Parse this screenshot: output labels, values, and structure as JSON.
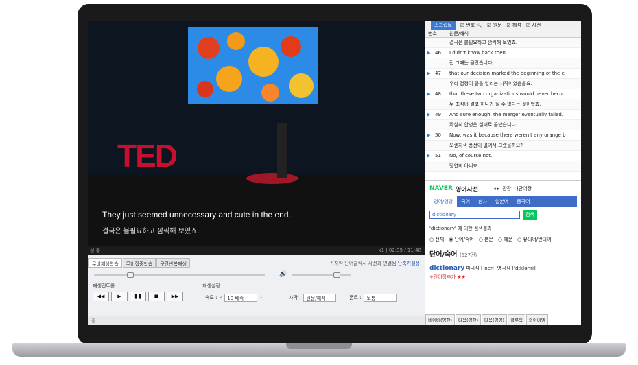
{
  "video": {
    "logo": "TED",
    "subtitle_en": "They just seemed unnecessary and cute in the end.",
    "subtitle_ko": "결국은 불필요하고 깜찍해 보였죠.",
    "status_left": "성 중",
    "status_right": "x1 | 02:39 / 11:48"
  },
  "controls": {
    "tabs": [
      "무비재생학습",
      "무비집중학습",
      "구간반복재생"
    ],
    "hint_text": "* 자막 단어클릭시 사전과 연결됨",
    "hint_link": "단축키설정",
    "playback_label": "재생컨트롤",
    "settings_label": "재생설정",
    "speed_label": "속도 :",
    "speed_value": "10 배속",
    "subtitle_label": "자막 :",
    "subtitle_value": "원문/해석",
    "font_label": "폰트 :",
    "font_value": "보통",
    "volume_level": 0.6
  },
  "bottom_status": "중",
  "transcript": {
    "toolbar": {
      "script": "스크립트",
      "number": "번호",
      "original": "원문",
      "translation": "해석",
      "dictionary": "사전"
    },
    "header": {
      "num": "번호",
      "text": "원문/해석"
    },
    "rows": [
      {
        "num": "",
        "text": "결국은 불필요하고 깜찍해 보였죠.",
        "lang": "ko"
      },
      {
        "num": "46",
        "text": "I didn't know back then",
        "lang": "en"
      },
      {
        "num": "",
        "text": "전 그때는 몰랐습니다.",
        "lang": "ko"
      },
      {
        "num": "47",
        "text": "that our decision marked the beginning of the e",
        "lang": "en"
      },
      {
        "num": "",
        "text": "우리 결정이 끝을 알리는 시작이었음을요.",
        "lang": "ko"
      },
      {
        "num": "48",
        "text": "that these two organizations would never becor",
        "lang": "en"
      },
      {
        "num": "",
        "text": "두 조직이 결코 하나가 될 수 없다는 것이었죠.",
        "lang": "ko"
      },
      {
        "num": "49",
        "text": "And sure enough, the merger eventually failed.",
        "lang": "en"
      },
      {
        "num": "",
        "text": "확실히 합병은 실패로 끝났습니다.",
        "lang": "ko"
      },
      {
        "num": "50",
        "text": "Now, was it because there weren't any orange b",
        "lang": "en"
      },
      {
        "num": "",
        "text": "오렌지색 풍선이 없어서 그랬을까요?",
        "lang": "ko"
      },
      {
        "num": "51",
        "text": "No, of course not.",
        "lang": "en"
      },
      {
        "num": "",
        "text": "당연히 아니죠.",
        "lang": "ko"
      }
    ]
  },
  "dictionary": {
    "logo": "NAVER",
    "title": "영어사전",
    "links": [
      "관장",
      "내단어장"
    ],
    "tabs": [
      "영어/영영",
      "국어",
      "한자",
      "일본어",
      "중국어"
    ],
    "query": "dictionary",
    "search_btn": "검색",
    "result_title": "'dictionary' 에 대한 검색결과",
    "filters": [
      "전체",
      "단어/숙어",
      "본문",
      "예문",
      "유의어/반의어"
    ],
    "section": "단어/숙어",
    "section_count": "(527건)",
    "entry_word": "dictionary",
    "entry_pron": "미국식 [-neri]  영국식 ['dɪkʃənri]",
    "add_word": "+단어장추가",
    "stars": "★★",
    "bottom_tabs": [
      "네이버(영한)",
      "다음(영한)",
      "다음(영영)",
      "콜루틱",
      "와이비엠"
    ]
  }
}
